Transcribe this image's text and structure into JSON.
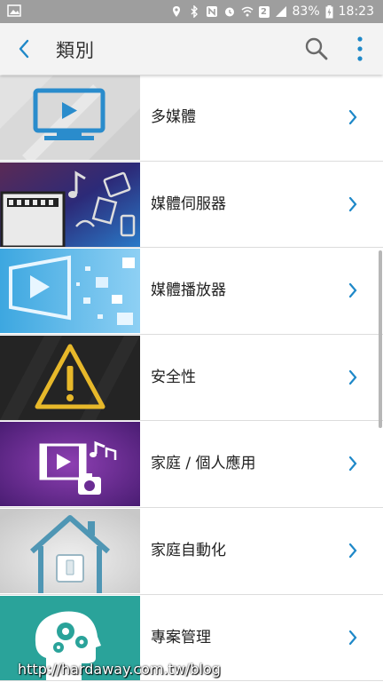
{
  "status_bar": {
    "battery_percent": "83%",
    "time": "18:23",
    "sim_label": "2"
  },
  "app_bar": {
    "title": "類別"
  },
  "categories": [
    {
      "label": "多媒體",
      "icon": "monitor-play-icon"
    },
    {
      "label": "媒體伺服器",
      "icon": "media-server-icon"
    },
    {
      "label": "媒體播放器",
      "icon": "media-player-icon"
    },
    {
      "label": "安全性",
      "icon": "warning-icon"
    },
    {
      "label": "家庭 / 個人應用",
      "icon": "home-personal-media-icon"
    },
    {
      "label": "家庭自動化",
      "icon": "home-automation-icon"
    },
    {
      "label": "專案管理",
      "icon": "project-management-icon"
    }
  ],
  "watermark": "http://hardaway.com.tw/blog",
  "colors": {
    "accent": "#1e88c8",
    "status_bar": "#9e9e9e"
  }
}
